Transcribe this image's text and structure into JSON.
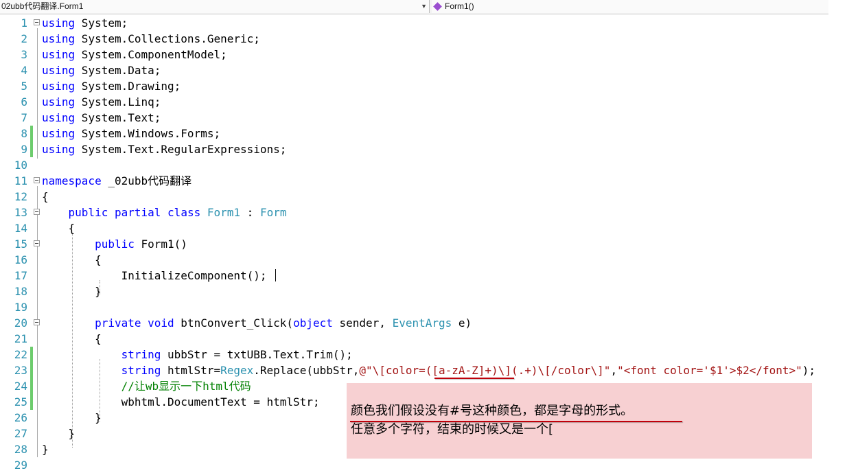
{
  "navbar": {
    "class_selector": "02ubb代码翻译.Form1",
    "member_selector": "Form1()"
  },
  "lines": [
    {
      "n": "1",
      "tokens": [
        {
          "t": "using",
          "c": "kw"
        },
        {
          "t": " System;",
          "c": ""
        }
      ]
    },
    {
      "n": "2",
      "tokens": [
        {
          "t": "using",
          "c": "kw"
        },
        {
          "t": " System.Collections.Generic;",
          "c": ""
        }
      ]
    },
    {
      "n": "3",
      "tokens": [
        {
          "t": "using",
          "c": "kw"
        },
        {
          "t": " System.ComponentModel;",
          "c": ""
        }
      ]
    },
    {
      "n": "4",
      "tokens": [
        {
          "t": "using",
          "c": "kw"
        },
        {
          "t": " System.Data;",
          "c": ""
        }
      ]
    },
    {
      "n": "5",
      "tokens": [
        {
          "t": "using",
          "c": "kw"
        },
        {
          "t": " System.Drawing;",
          "c": ""
        }
      ]
    },
    {
      "n": "6",
      "tokens": [
        {
          "t": "using",
          "c": "kw"
        },
        {
          "t": " System.Linq;",
          "c": ""
        }
      ]
    },
    {
      "n": "7",
      "tokens": [
        {
          "t": "using",
          "c": "kw"
        },
        {
          "t": " System.Text;",
          "c": ""
        }
      ]
    },
    {
      "n": "8",
      "tokens": [
        {
          "t": "using",
          "c": "kw"
        },
        {
          "t": " System.Windows.Forms;",
          "c": ""
        }
      ]
    },
    {
      "n": "9",
      "tokens": [
        {
          "t": "using",
          "c": "kw"
        },
        {
          "t": " System.Text.RegularExpressions;",
          "c": ""
        }
      ]
    },
    {
      "n": "10",
      "tokens": []
    },
    {
      "n": "11",
      "tokens": [
        {
          "t": "namespace",
          "c": "kw"
        },
        {
          "t": " _02ubb代码翻译",
          "c": ""
        }
      ]
    },
    {
      "n": "12",
      "tokens": [
        {
          "t": "{",
          "c": ""
        }
      ]
    },
    {
      "n": "13",
      "tokens": [
        {
          "t": "    ",
          "c": ""
        },
        {
          "t": "public",
          "c": "kw"
        },
        {
          "t": " ",
          "c": ""
        },
        {
          "t": "partial",
          "c": "kw"
        },
        {
          "t": " ",
          "c": ""
        },
        {
          "t": "class",
          "c": "kw"
        },
        {
          "t": " ",
          "c": ""
        },
        {
          "t": "Form1",
          "c": "ty"
        },
        {
          "t": " : ",
          "c": ""
        },
        {
          "t": "Form",
          "c": "ty"
        }
      ]
    },
    {
      "n": "14",
      "tokens": [
        {
          "t": "    {",
          "c": ""
        }
      ]
    },
    {
      "n": "15",
      "tokens": [
        {
          "t": "        ",
          "c": ""
        },
        {
          "t": "public",
          "c": "kw"
        },
        {
          "t": " Form1()",
          "c": ""
        }
      ]
    },
    {
      "n": "16",
      "tokens": [
        {
          "t": "        {",
          "c": ""
        }
      ]
    },
    {
      "n": "17",
      "tokens": [
        {
          "t": "            InitializeComponent();",
          "c": ""
        }
      ]
    },
    {
      "n": "18",
      "tokens": [
        {
          "t": "        }",
          "c": ""
        }
      ]
    },
    {
      "n": "19",
      "tokens": []
    },
    {
      "n": "20",
      "tokens": [
        {
          "t": "        ",
          "c": ""
        },
        {
          "t": "private",
          "c": "kw"
        },
        {
          "t": " ",
          "c": ""
        },
        {
          "t": "void",
          "c": "kw"
        },
        {
          "t": " btnConvert_Click(",
          "c": ""
        },
        {
          "t": "object",
          "c": "kw"
        },
        {
          "t": " sender, ",
          "c": ""
        },
        {
          "t": "EventArgs",
          "c": "ty"
        },
        {
          "t": " e)",
          "c": ""
        }
      ]
    },
    {
      "n": "21",
      "tokens": [
        {
          "t": "        {",
          "c": ""
        }
      ]
    },
    {
      "n": "22",
      "tokens": [
        {
          "t": "            ",
          "c": ""
        },
        {
          "t": "string",
          "c": "kw"
        },
        {
          "t": " ubbStr = txtUBB.Text.Trim();",
          "c": ""
        }
      ]
    },
    {
      "n": "23",
      "tokens": [
        {
          "t": "            ",
          "c": ""
        },
        {
          "t": "string",
          "c": "kw"
        },
        {
          "t": " htmlStr=",
          "c": ""
        },
        {
          "t": "Regex",
          "c": "ty"
        },
        {
          "t": ".Replace(ubbStr,",
          "c": ""
        },
        {
          "t": "@\"\\[color=([a-zA-Z]+)\\](.+)\\[/color\\]\"",
          "c": "str"
        },
        {
          "t": ",",
          "c": ""
        },
        {
          "t": "\"<font color='$1'>$2</font>\"",
          "c": "str"
        },
        {
          "t": ");",
          "c": ""
        }
      ]
    },
    {
      "n": "24",
      "tokens": [
        {
          "t": "            ",
          "c": ""
        },
        {
          "t": "//让wb显示一下html代码",
          "c": "cm"
        }
      ]
    },
    {
      "n": "25",
      "tokens": [
        {
          "t": "            wbhtml.DocumentText = htmlStr;",
          "c": ""
        }
      ]
    },
    {
      "n": "26",
      "tokens": [
        {
          "t": "        }",
          "c": ""
        }
      ]
    },
    {
      "n": "27",
      "tokens": [
        {
          "t": "    }",
          "c": ""
        }
      ]
    },
    {
      "n": "28",
      "tokens": [
        {
          "t": "}",
          "c": ""
        }
      ]
    },
    {
      "n": "29",
      "tokens": []
    }
  ],
  "modified_lines": [
    "8",
    "9",
    "22",
    "23",
    "24",
    "25"
  ],
  "fold_lines": [
    "1",
    "11",
    "13",
    "15",
    "20"
  ],
  "note": {
    "line1": "颜色我们假设没有#号这种颜色，都是字母的形式。",
    "line2": "任意多个字符，结束的时候又是一个["
  },
  "colors": {
    "keyword": "#0000ff",
    "type": "#2b91af",
    "string": "#a31515",
    "comment": "#008000",
    "line_number": "#2b91af",
    "annotation_bg": "#f7d0d2",
    "underline": "#c0000a"
  }
}
